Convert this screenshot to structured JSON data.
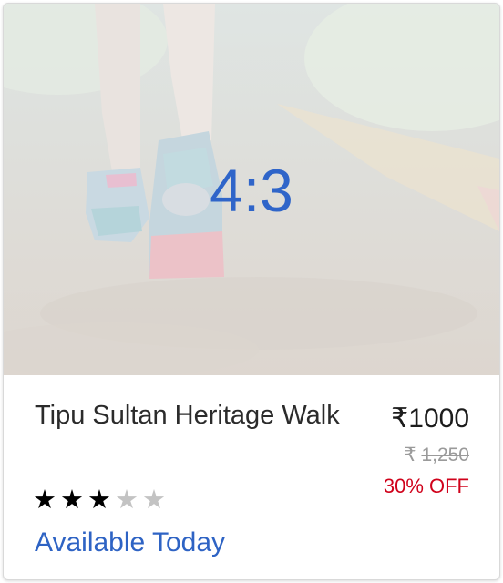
{
  "media": {
    "overlay_label": "4:3",
    "image_subject": "walking shoes on a path"
  },
  "event": {
    "title": "Tipu Sultan Heritage Walk",
    "rating": {
      "value": 3,
      "max": 5
    },
    "availability": "Available Today"
  },
  "pricing": {
    "currency_symbol": "₹",
    "price": "₹1000",
    "original_price": "1,250",
    "discount": "30% OFF"
  },
  "colors": {
    "accent": "#2e63c4",
    "discount": "#d0021b",
    "star_filled": "#000000",
    "star_empty": "#c3c3c3"
  }
}
